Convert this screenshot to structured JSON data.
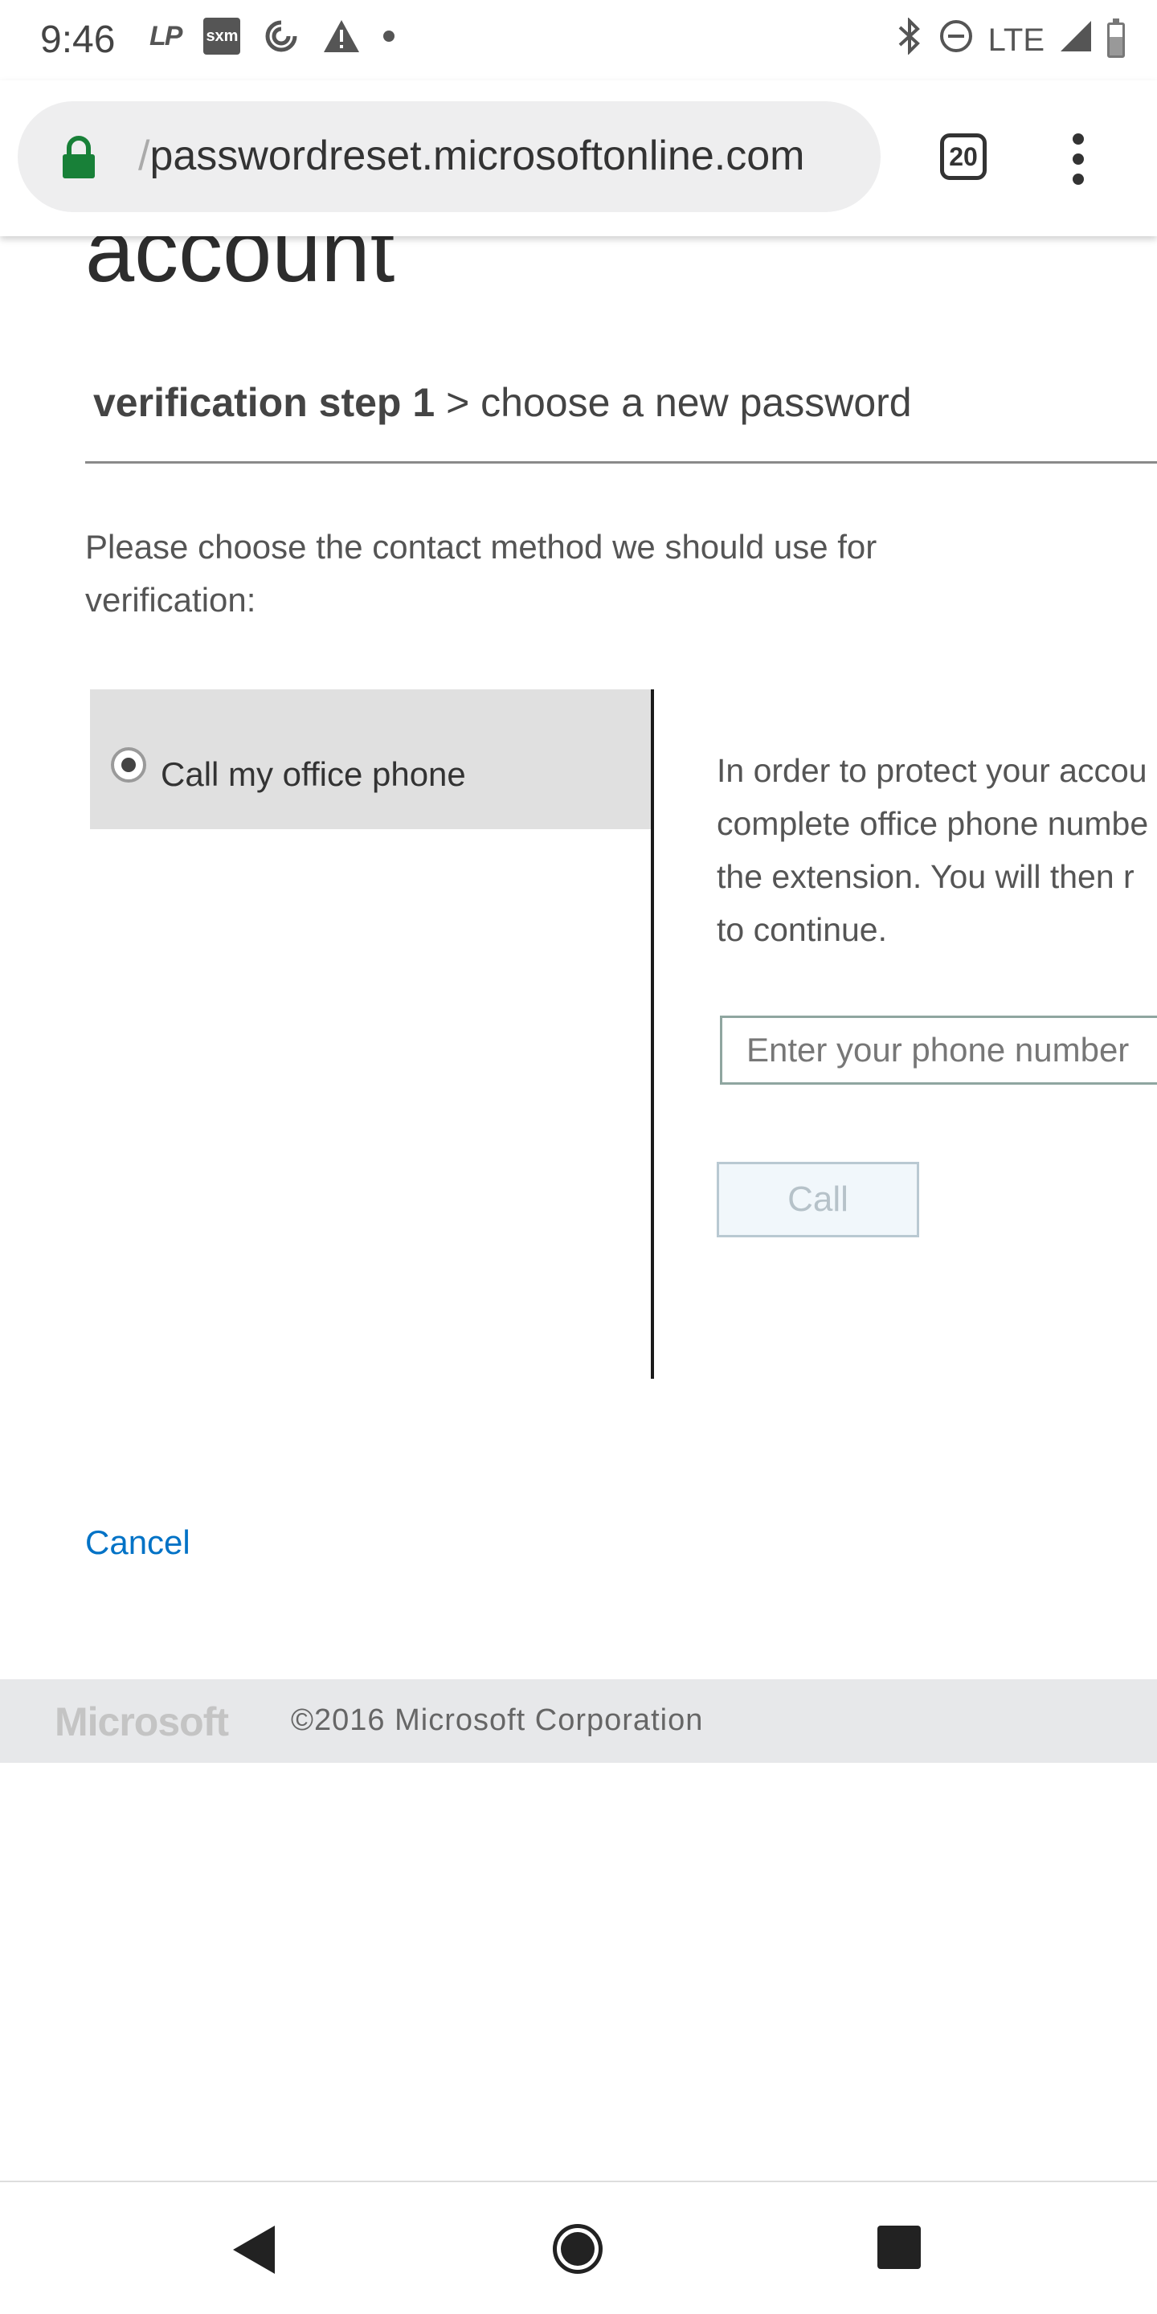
{
  "status_bar": {
    "time": "9:46",
    "icons_left": [
      "lp-icon",
      "sxm-icon",
      "sync-icon",
      "warning-icon",
      "notification-dot-icon"
    ],
    "lp_text": "LP",
    "sxm_text": "sxm",
    "network": "LTE",
    "icons_right": [
      "bluetooth-icon",
      "do-not-disturb-icon",
      "signal-icon",
      "battery-icon"
    ]
  },
  "browser": {
    "url_prefix": "/",
    "url": "passwordreset.microsoftonline.com",
    "tab_count": "20",
    "lock_color": "#188038"
  },
  "page": {
    "title": "account",
    "steps": {
      "current": "verification step 1",
      "separator": ">",
      "next": "choose a new password"
    },
    "instructions": "Please choose the contact method we should use for verification:",
    "method": {
      "label": "Call my office phone",
      "selected": true
    },
    "info_lines": [
      "In order to protect your accou",
      "complete office phone numbe",
      "the extension. You will then r",
      "to continue."
    ],
    "phone_input": {
      "placeholder": "Enter your phone number",
      "value": ""
    },
    "call_button": "Call",
    "cancel_link": "Cancel",
    "link_color": "#0072c6"
  },
  "footer": {
    "logo_text": "Microsoft",
    "copyright": "©2016 Microsoft Corporation"
  },
  "nav": {
    "buttons": [
      "back-icon",
      "home-icon",
      "recents-icon"
    ]
  }
}
